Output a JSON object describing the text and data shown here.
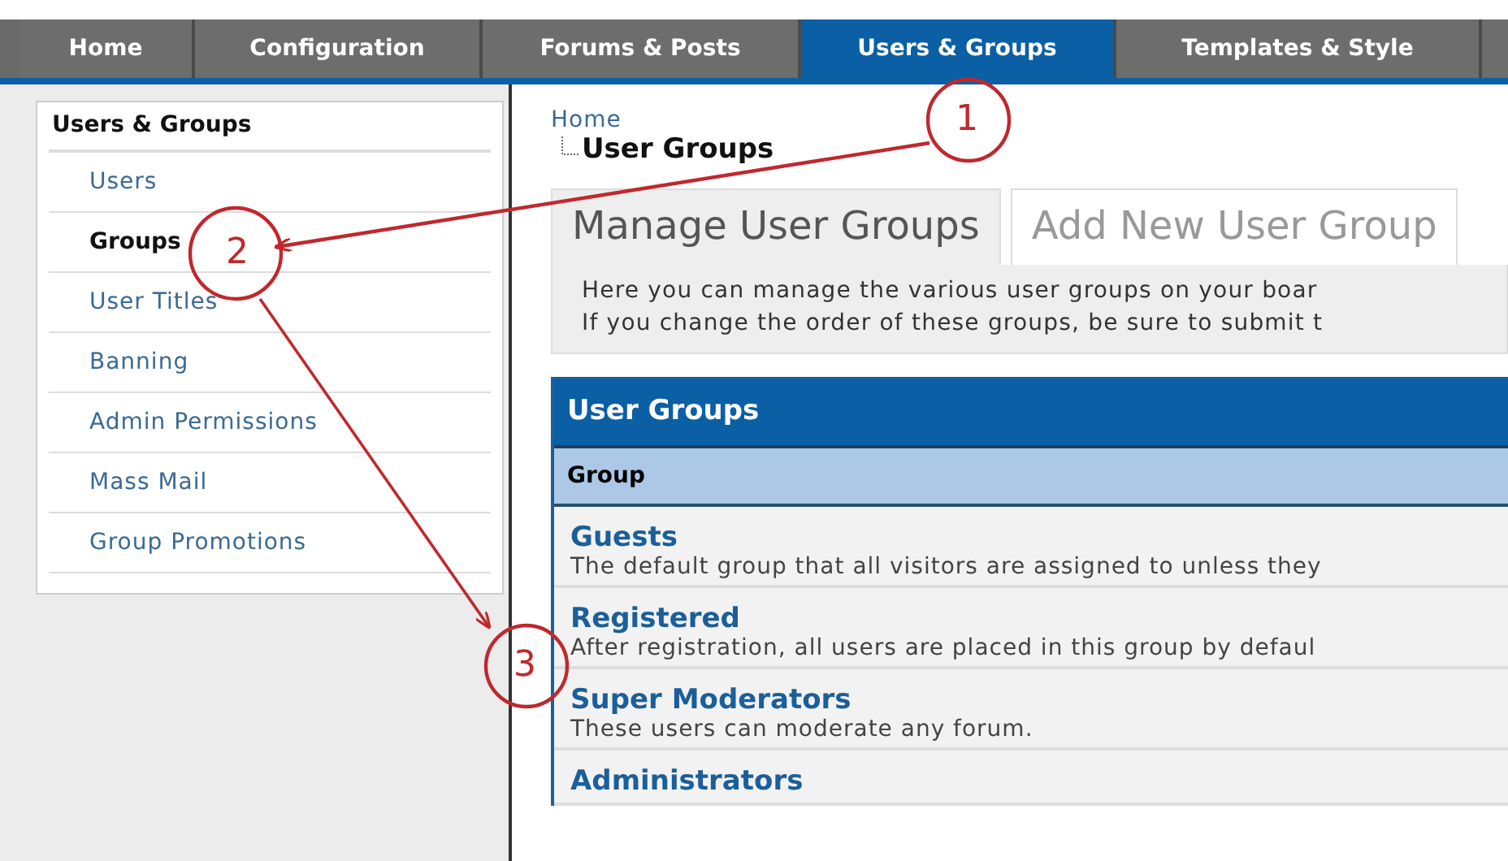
{
  "nav_tabs": [
    {
      "label": "Home",
      "selected": false
    },
    {
      "label": "Configuration",
      "selected": false
    },
    {
      "label": "Forums & Posts",
      "selected": false
    },
    {
      "label": "Users & Groups",
      "selected": true
    },
    {
      "label": "Templates & Style",
      "selected": false
    }
  ],
  "sidebar": {
    "title": "Users & Groups",
    "items": [
      {
        "label": "Users",
        "selected": false
      },
      {
        "label": "Groups",
        "selected": true
      },
      {
        "label": "User Titles",
        "selected": false
      },
      {
        "label": "Banning",
        "selected": false
      },
      {
        "label": "Admin Permissions",
        "selected": false
      },
      {
        "label": "Mass Mail",
        "selected": false
      },
      {
        "label": "Group Promotions",
        "selected": false
      }
    ]
  },
  "breadcrumb": {
    "parent": "Home",
    "current": "User Groups"
  },
  "page_tabs": [
    {
      "label": "Manage User Groups",
      "selected": true
    },
    {
      "label": "Add New User Group",
      "selected": false
    }
  ],
  "description": [
    "Here you can manage the various user groups on your boar",
    "If you change the order of these groups, be sure to submit t"
  ],
  "table": {
    "title": "User Groups",
    "columns": [
      "Group"
    ],
    "rows": [
      {
        "name": "Guests",
        "description": "The default group that all visitors are assigned to unless they"
      },
      {
        "name": "Registered",
        "description": "After registration, all users are placed in this group by defaul"
      },
      {
        "name": "Super Moderators",
        "description": "These users can moderate any forum."
      },
      {
        "name": "Administrators",
        "description": ""
      }
    ]
  },
  "annotations": [
    {
      "label": "1"
    },
    {
      "label": "2"
    },
    {
      "label": "3"
    }
  ]
}
